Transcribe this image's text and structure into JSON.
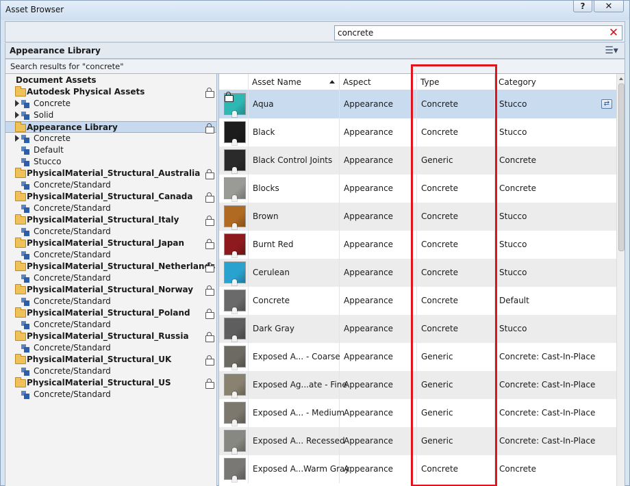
{
  "window": {
    "title": "Asset Browser",
    "help_label": "?",
    "close_label": "✕"
  },
  "search": {
    "value": "concrete",
    "clear_icon": "red-x-icon"
  },
  "library": {
    "header": "Appearance Library",
    "results_text": "Search results for \"concrete\""
  },
  "tree": {
    "items": [
      {
        "label": "Document Assets",
        "kind": "section",
        "bold": true
      },
      {
        "label": "Autodesk Physical Assets",
        "kind": "folder",
        "bold": true,
        "locked": true
      },
      {
        "label": "Concrete",
        "kind": "category",
        "expandable": true
      },
      {
        "label": "Solid",
        "kind": "category",
        "expandable": true
      },
      {
        "label": "Appearance Library",
        "kind": "folder",
        "bold": true,
        "locked": true,
        "selected": true
      },
      {
        "label": "Concrete",
        "kind": "category",
        "expandable": true
      },
      {
        "label": "Default",
        "kind": "category"
      },
      {
        "label": "Stucco",
        "kind": "category"
      },
      {
        "label": "PhysicalMaterial_Structural_Australia",
        "kind": "folder",
        "bold": true,
        "locked": true
      },
      {
        "label": "Concrete/Standard",
        "kind": "category"
      },
      {
        "label": "PhysicalMaterial_Structural_Canada",
        "kind": "folder",
        "bold": true,
        "locked": true
      },
      {
        "label": "Concrete/Standard",
        "kind": "category"
      },
      {
        "label": "PhysicalMaterial_Structural_Italy",
        "kind": "folder",
        "bold": true,
        "locked": true
      },
      {
        "label": "Concrete/Standard",
        "kind": "category"
      },
      {
        "label": "PhysicalMaterial_Structural_Japan",
        "kind": "folder",
        "bold": true,
        "locked": true
      },
      {
        "label": "Concrete/Standard",
        "kind": "category"
      },
      {
        "label": "PhysicalMaterial_Structural_Netherlands",
        "kind": "folder",
        "bold": true,
        "locked": true
      },
      {
        "label": "Concrete/Standard",
        "kind": "category"
      },
      {
        "label": "PhysicalMaterial_Structural_Norway",
        "kind": "folder",
        "bold": true,
        "locked": true
      },
      {
        "label": "Concrete/Standard",
        "kind": "category"
      },
      {
        "label": "PhysicalMaterial_Structural_Poland",
        "kind": "folder",
        "bold": true,
        "locked": true
      },
      {
        "label": "Concrete/Standard",
        "kind": "category"
      },
      {
        "label": "PhysicalMaterial_Structural_Russia",
        "kind": "folder",
        "bold": true,
        "locked": true
      },
      {
        "label": "Concrete/Standard",
        "kind": "category"
      },
      {
        "label": "PhysicalMaterial_Structural_UK",
        "kind": "folder",
        "bold": true,
        "locked": true
      },
      {
        "label": "Concrete/Standard",
        "kind": "category"
      },
      {
        "label": "PhysicalMaterial_Structural_US",
        "kind": "folder",
        "bold": true,
        "locked": true
      },
      {
        "label": "Concrete/Standard",
        "kind": "category"
      }
    ]
  },
  "grid": {
    "columns": [
      "Asset Name",
      "Aspect",
      "Type",
      "Category"
    ],
    "sorted_column": "Asset Name",
    "rows": [
      {
        "name": "Aqua",
        "aspect": "Appearance",
        "type": "Concrete",
        "category": "Stucco",
        "swatch": "#2fb7b4",
        "locked": true,
        "selected": true
      },
      {
        "name": "Black",
        "aspect": "Appearance",
        "type": "Concrete",
        "category": "Stucco",
        "swatch": "#1c1c1c"
      },
      {
        "name": "Black Control Joints",
        "aspect": "Appearance",
        "type": "Generic",
        "category": "Concrete",
        "swatch": "#2a2a2a"
      },
      {
        "name": "Blocks",
        "aspect": "Appearance",
        "type": "Concrete",
        "category": "Concrete",
        "swatch": "#9a9a96"
      },
      {
        "name": "Brown",
        "aspect": "Appearance",
        "type": "Concrete",
        "category": "Stucco",
        "swatch": "#b06a22"
      },
      {
        "name": "Burnt Red",
        "aspect": "Appearance",
        "type": "Concrete",
        "category": "Stucco",
        "swatch": "#8e1a1e"
      },
      {
        "name": "Cerulean",
        "aspect": "Appearance",
        "type": "Concrete",
        "category": "Stucco",
        "swatch": "#2aa2cf"
      },
      {
        "name": "Concrete",
        "aspect": "Appearance",
        "type": "Concrete",
        "category": "Default",
        "swatch": "#6a6a6a"
      },
      {
        "name": "Dark Gray",
        "aspect": "Appearance",
        "type": "Concrete",
        "category": "Stucco",
        "swatch": "#5e5e5e"
      },
      {
        "name": "Exposed A... - Coarse",
        "aspect": "Appearance",
        "type": "Generic",
        "category": "Concrete: Cast-In-Place",
        "swatch": "#6d6a63"
      },
      {
        "name": "Exposed Ag...ate - Fine",
        "aspect": "Appearance",
        "type": "Generic",
        "category": "Concrete: Cast-In-Place",
        "swatch": "#8a8270"
      },
      {
        "name": "Exposed A... - Medium",
        "aspect": "Appearance",
        "type": "Generic",
        "category": "Concrete: Cast-In-Place",
        "swatch": "#7d786e"
      },
      {
        "name": "Exposed A... Recessed",
        "aspect": "Appearance",
        "type": "Generic",
        "category": "Concrete: Cast-In-Place",
        "swatch": "#888882"
      },
      {
        "name": "Exposed A...Warm Gray",
        "aspect": "Appearance",
        "type": "Concrete",
        "category": "Concrete",
        "swatch": "#7a7874"
      }
    ]
  },
  "colors": {
    "highlight_box": "#e0141c",
    "selected_row": "#c9dbef",
    "tree_selection": "#c7d9ee"
  }
}
